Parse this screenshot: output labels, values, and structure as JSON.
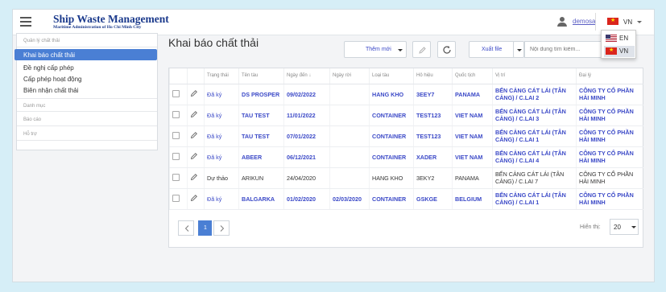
{
  "header": {
    "title": "Ship Waste Management",
    "subtitle": "Maritime Administration of Ho Chi Minh City",
    "user": "demosa",
    "language": "VN",
    "language_options": [
      {
        "code": "EN",
        "flag": "us-flag-icon"
      },
      {
        "code": "VN",
        "flag": "vn-flag-icon"
      }
    ]
  },
  "sidebar": {
    "section_waste": "Quản lý chất thải",
    "items": [
      {
        "label": "Khai báo chất thải"
      },
      {
        "label": "Đề nghị cấp phép"
      },
      {
        "label": "Cấp phép hoạt động"
      },
      {
        "label": "Biên nhận chất thải"
      }
    ],
    "section_catalog": "Danh mục",
    "section_reports": "Báo cáo",
    "section_support": "Hỗ trợ"
  },
  "page": {
    "title": "Khai báo chất thải",
    "add_new_label": "Thêm mới",
    "export_label": "Xuất file",
    "search_placeholder": "Nội dung tìm kiếm..."
  },
  "table": {
    "columns": [
      "Trạng thái",
      "Tên tàu",
      "Ngày đến ↓",
      "Ngày rời",
      "Loại tàu",
      "Hô hiệu",
      "Quốc tịch",
      "Vị trí",
      "Đại lý"
    ],
    "rows": [
      {
        "status": "Đã ký",
        "ship": "DS PROSPER",
        "arrival": "09/02/2022",
        "departure": "",
        "type": "HANG KHO",
        "callsign": "3EEY7",
        "nationality": "PANAMA",
        "location": "BẾN CẢNG CÁT LÁI (TÂN CẢNG) / C.LAI 2",
        "agent": "CÔNG TY CỔ PHẦN HẢI MINH"
      },
      {
        "status": "Đã ký",
        "ship": "TAU TEST",
        "arrival": "11/01/2022",
        "departure": "",
        "type": "CONTAINER",
        "callsign": "TEST123",
        "nationality": "VIET NAM",
        "location": "BẾN CẢNG CÁT LÁI (TÂN CẢNG) / C.LAI 3",
        "agent": "CÔNG TY CỔ PHẦN HẢI MINH"
      },
      {
        "status": "Đã ký",
        "ship": "TAU TEST",
        "arrival": "07/01/2022",
        "departure": "",
        "type": "CONTAINER",
        "callsign": "TEST123",
        "nationality": "VIET NAM",
        "location": "BẾN CẢNG CÁT LÁI (TÂN CẢNG) / C.LAI 1",
        "agent": "CÔNG TY CỔ PHẦN HẢI MINH"
      },
      {
        "status": "Đã ký",
        "ship": "ABEER",
        "arrival": "06/12/2021",
        "departure": "",
        "type": "CONTAINER",
        "callsign": "XADER",
        "nationality": "VIET NAM",
        "location": "BẾN CẢNG CÁT LÁI (TÂN CẢNG) / C.LAI 4",
        "agent": "CÔNG TY CỔ PHẦN HẢI MINH"
      },
      {
        "status": "Dự thảo",
        "ship": "ARIKUN",
        "arrival": "24/04/2020",
        "departure": "",
        "type": "HANG KHO",
        "callsign": "3EKY2",
        "nationality": "PANAMA",
        "location": "BẾN CẢNG CÁT LÁI (TÂN CẢNG) / C.LAI 7",
        "agent": "CÔNG TY CỔ PHẦN HẢI MINH"
      },
      {
        "status": "Đã ký",
        "ship": "BALGARKA",
        "arrival": "01/02/2020",
        "departure": "02/03/2020",
        "type": "CONTAINER",
        "callsign": "GSKGE",
        "nationality": "BELGIUM",
        "location": "BẾN CẢNG CÁT LÁI (TÂN CẢNG) / C.LAI 1",
        "agent": "CÔNG TY CỔ PHẦN HẢI MINH"
      }
    ]
  },
  "pagination": {
    "current_page": "1",
    "page_size_label": "Hiển thị:",
    "page_size": "20"
  },
  "colors": {
    "accent": "#3b49c7",
    "active": "#4a7fd4",
    "brand": "#1b3a8c"
  }
}
